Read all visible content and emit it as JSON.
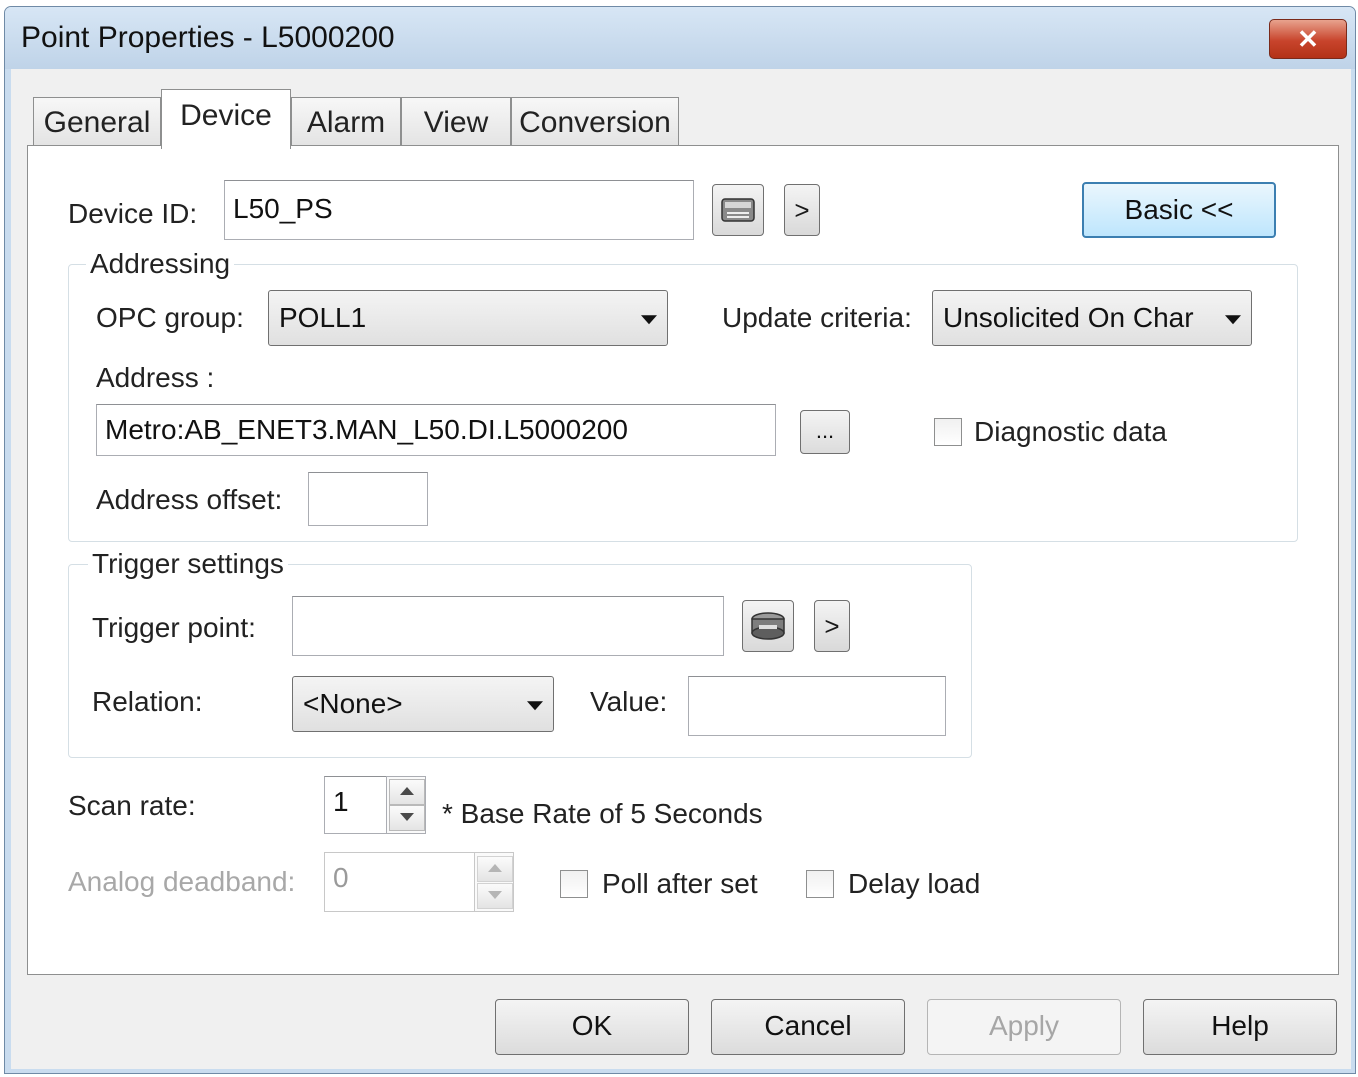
{
  "window": {
    "title": "Point Properties - L5000200",
    "close_glyph": "✕"
  },
  "tabs": [
    {
      "label": "General",
      "active": false
    },
    {
      "label": "Device",
      "active": true
    },
    {
      "label": "Alarm",
      "active": false
    },
    {
      "label": "View",
      "active": false
    },
    {
      "label": "Conversion",
      "active": false
    }
  ],
  "device": {
    "id_label": "Device ID:",
    "id_value": "L50_PS",
    "browse_icon": "device-browse-icon",
    "next_label": ">",
    "basic_button": "Basic <<"
  },
  "addressing": {
    "group_title": "Addressing",
    "opc_group_label": "OPC group:",
    "opc_group_value": "POLL1",
    "update_criteria_label": "Update criteria:",
    "update_criteria_value": "Unsolicited On Char",
    "address_label": "Address :",
    "address_value": "Metro:AB_ENET3.MAN_L50.DI.L5000200",
    "address_browse_label": "...",
    "diagnostic_label": "Diagnostic data",
    "diagnostic_checked": false,
    "offset_label": "Address offset:",
    "offset_value": ""
  },
  "trigger": {
    "group_title": "Trigger settings",
    "point_label": "Trigger point:",
    "point_value": "",
    "point_browse_icon": "trigger-browse-icon",
    "next_label": ">",
    "relation_label": "Relation:",
    "relation_value": "<None>",
    "value_label": "Value:",
    "value_value": ""
  },
  "scan": {
    "rate_label": "Scan rate:",
    "rate_value": "1",
    "rate_note": "* Base Rate of 5 Seconds",
    "deadband_label": "Analog deadband:",
    "deadband_value": "0",
    "poll_after_set_label": "Poll after set",
    "poll_after_set_checked": false,
    "delay_load_label": "Delay load",
    "delay_load_checked": false
  },
  "footer": {
    "ok": "OK",
    "cancel": "Cancel",
    "apply": "Apply",
    "help": "Help"
  },
  "colors": {
    "title_bar": "#c9dcef",
    "close_button": "#c8442c",
    "focus_border": "#3c7fb1",
    "disabled_text": "#a8a8a8"
  }
}
